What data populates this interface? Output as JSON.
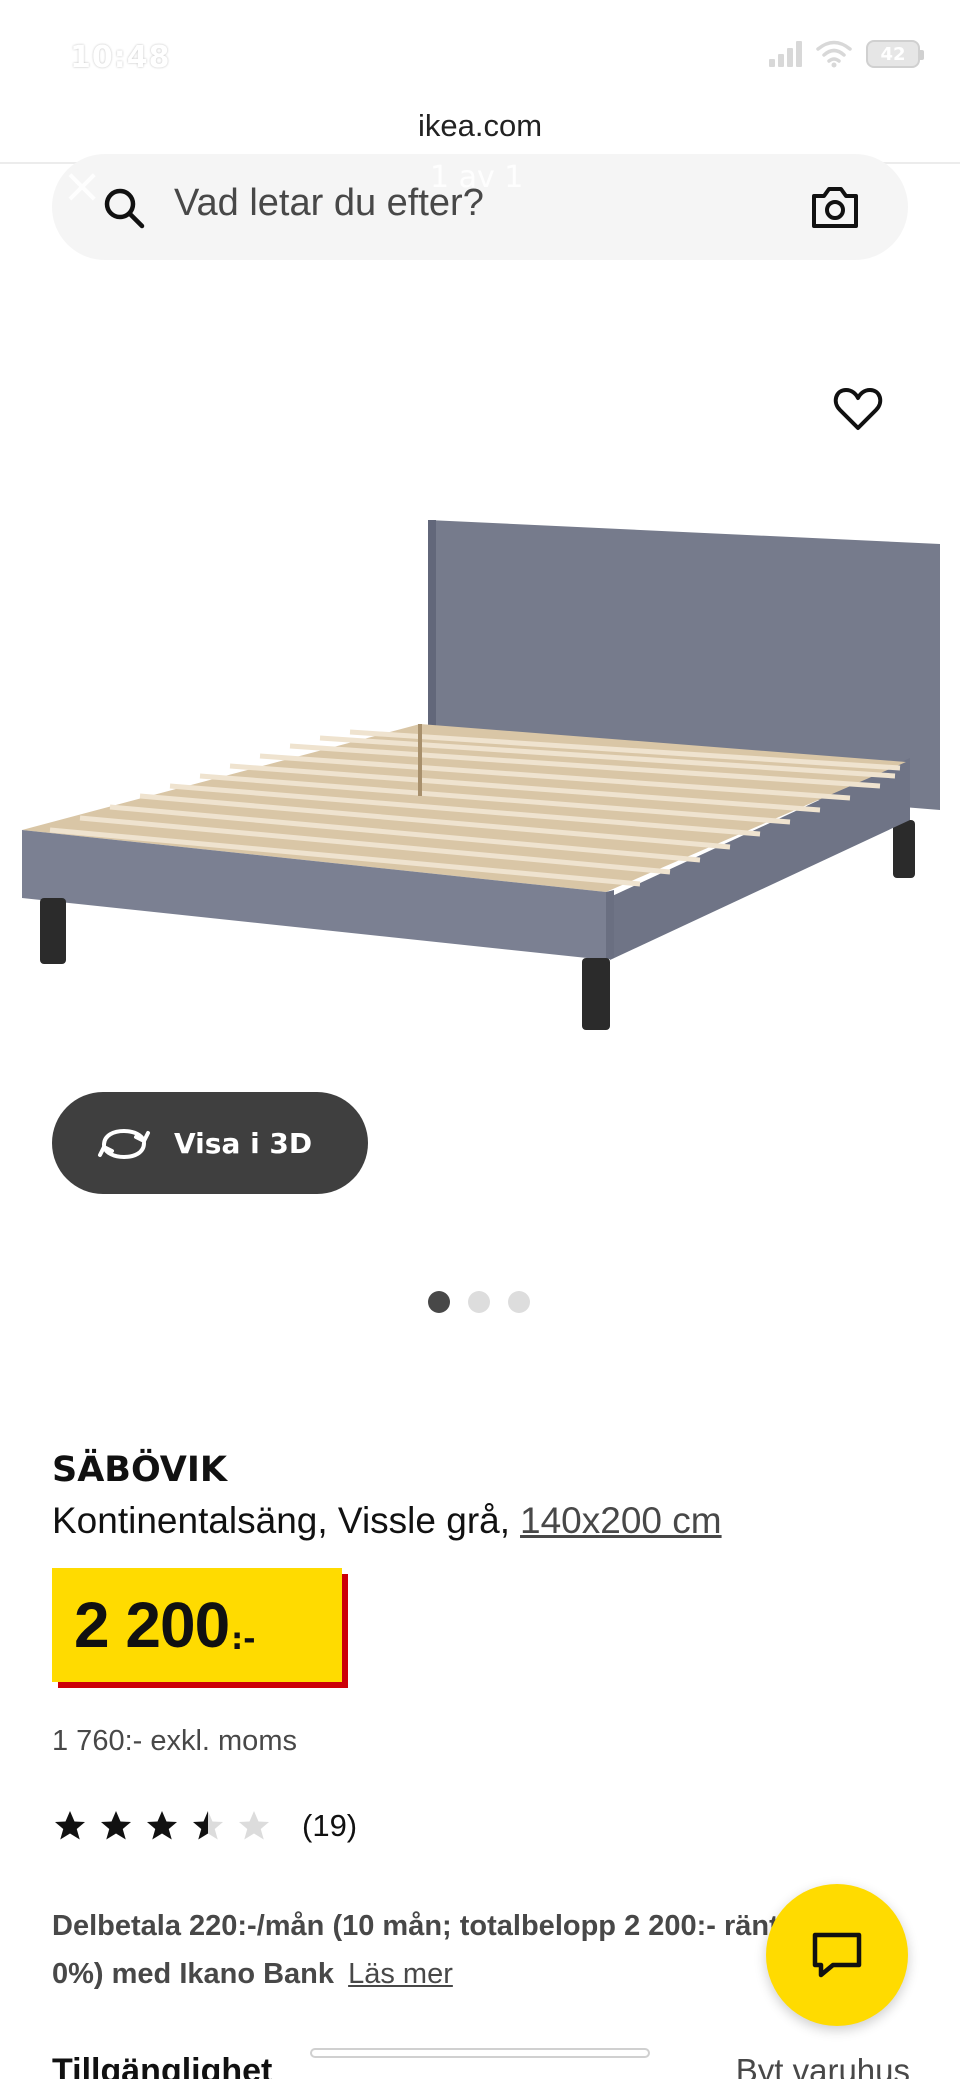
{
  "status_bar": {
    "time": "10:48",
    "battery": "42"
  },
  "browser": {
    "url": "ikea.com"
  },
  "overlay": {
    "close_glyph": "×",
    "counter": "1 av 1"
  },
  "search": {
    "placeholder": "Vad letar du efter?"
  },
  "gallery": {
    "view_3d_label": "Visa i 3D",
    "dot_count": 3,
    "active_index": 0
  },
  "product": {
    "name": "SÄBÖVIK",
    "description": "Kontinentalsäng, Vissle grå,",
    "size": "140x200 cm",
    "price": "2 200",
    "price_suffix": ":-",
    "price_excl_vat": "1 760:- exkl. moms",
    "rating_value": 3.5,
    "rating_max": 5,
    "rating_count": "(19)",
    "financing_text": "Delbetala 220:-/mån (10 mån; totalbelopp 2 200:- ränta 0%) med Ikano Bank",
    "financing_link": "Läs mer"
  },
  "availability": {
    "label": "Tillgänglighet",
    "change_store": "Byt varuhus"
  },
  "colors": {
    "ikea_yellow": "#ffdb00",
    "price_shadow_red": "#cc0008",
    "dark_button": "#3f3f3f"
  },
  "icons": [
    "search-icon",
    "camera-icon",
    "heart-icon",
    "rotate-3d-icon",
    "star-icon",
    "chat-icon"
  ]
}
